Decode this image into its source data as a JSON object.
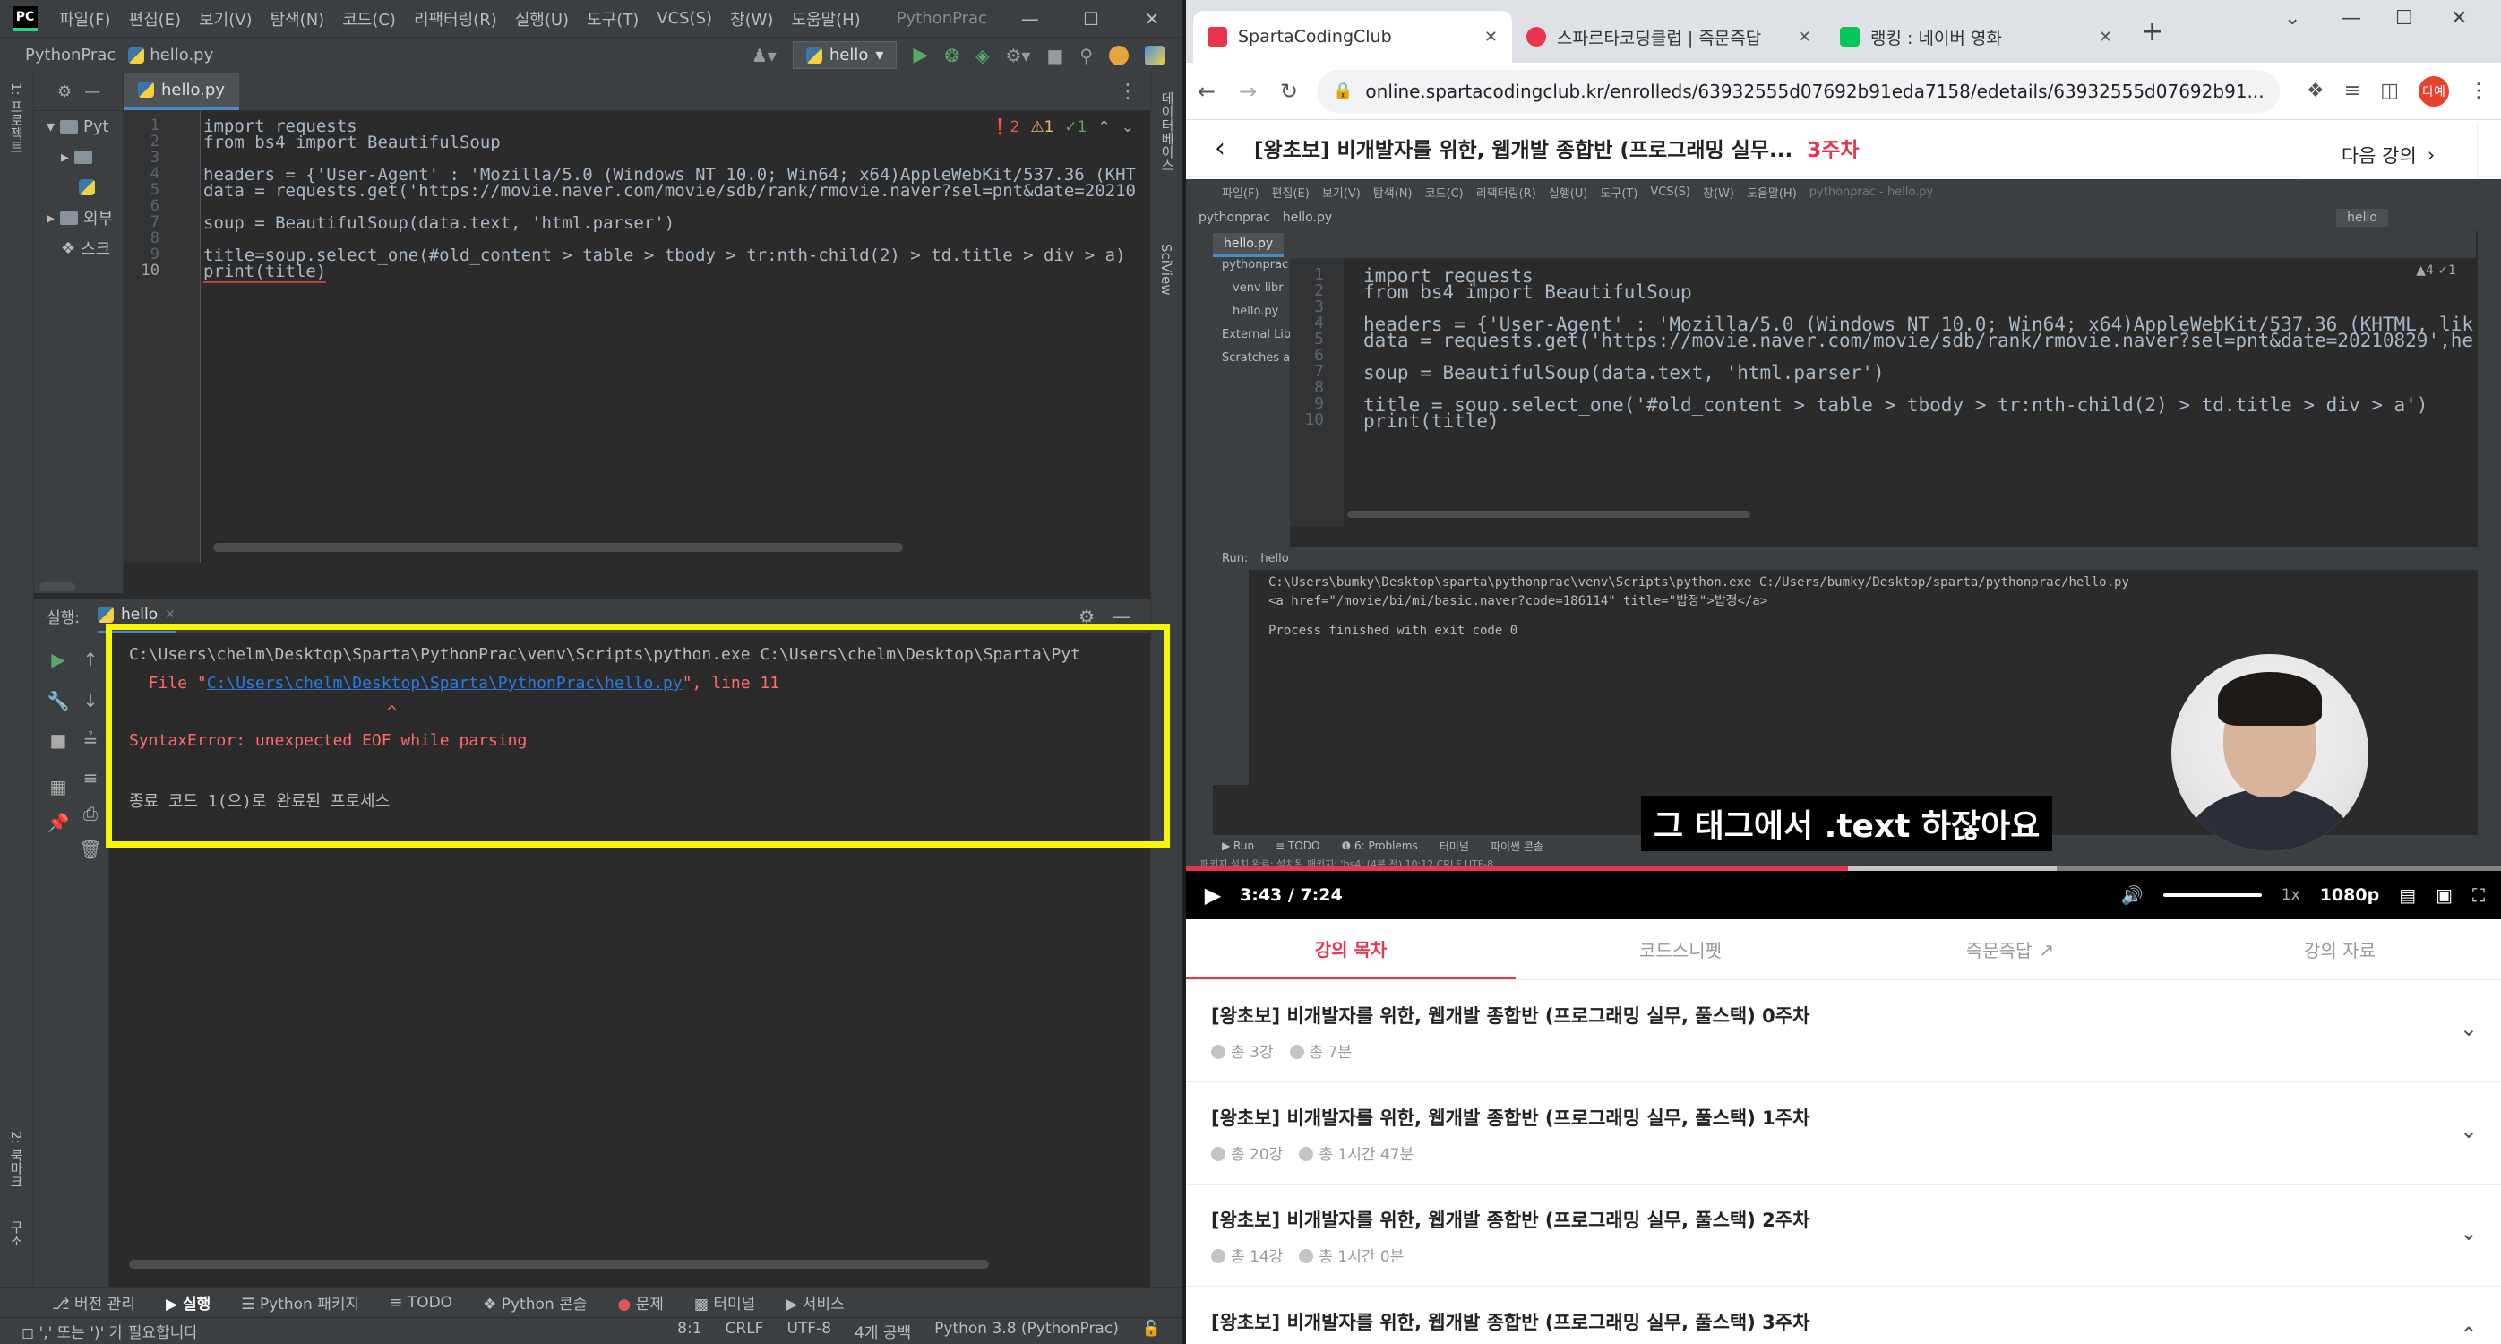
{
  "ide": {
    "menu": [
      "파일(F)",
      "편집(E)",
      "보기(V)",
      "탐색(N)",
      "코드(C)",
      "리팩터링(R)",
      "실행(U)",
      "도구(T)",
      "VCS(S)",
      "창(W)",
      "도움말(H)"
    ],
    "window_title": "PythonPrac",
    "breadcrumb_project": "PythonPrac",
    "breadcrumb_file": "hello.py",
    "run_config": "hello",
    "project_tree": [
      "Pyt",
      "외부",
      "스크"
    ],
    "left_strip_label": "1: 프로젝트",
    "left_strip_label_bottom": "2: 북마크",
    "left_strip_label_bottom2": "구조",
    "right_strip_label": "데이터베이스",
    "right_strip_label2": "SciView",
    "editor_tab": "hello.py",
    "inspections": {
      "errors": "2",
      "warnings": "1",
      "ok": "1"
    },
    "code": [
      {
        "no": "1",
        "text": "import requests"
      },
      {
        "no": "2",
        "text": "from bs4 import BeautifulSoup"
      },
      {
        "no": "3",
        "text": ""
      },
      {
        "no": "4",
        "text": "headers = {'User-Agent' : 'Mozilla/5.0 (Windows NT 10.0; Win64; x64)AppleWebKit/537.36 (KHT"
      },
      {
        "no": "5",
        "text": "data = requests.get('https://movie.naver.com/movie/sdb/rank/rmovie.naver?sel=pnt&date=20210"
      },
      {
        "no": "6",
        "text": ""
      },
      {
        "no": "7",
        "text": "soup = BeautifulSoup(data.text, 'html.parser')"
      },
      {
        "no": "8",
        "text": ""
      },
      {
        "no": "9",
        "text": "title=soup.select_one(#old_content > table > tbody > tr:nth-child(2) > td.title > div > a)"
      },
      {
        "no": "10",
        "text": "print(title)"
      }
    ],
    "run_label": "실행:",
    "run_tab": "hello",
    "console": {
      "line1": "C:\\Users\\chelm\\Desktop\\Sparta\\PythonPrac\\venv\\Scripts\\python.exe C:\\Users\\chelm\\Desktop\\Sparta\\Pyt",
      "line2_prefix": "  File \"",
      "line2_link": "C:\\Users\\chelm\\Desktop\\Sparta\\PythonPrac\\hello.py",
      "line2_suffix": "\", line 11",
      "caret": "^",
      "error": "SyntaxError: unexpected EOF while parsing",
      "exit": "종료 코드 1(으)로 완료된 프로세스"
    },
    "tool_tabs": [
      "버전 관리",
      "실행",
      "Python 패키지",
      "TODO",
      "Python 콘솔",
      "문제",
      "터미널",
      "서비스"
    ],
    "status": {
      "message": "',' 또는 ')' 가 필요합니다",
      "position": "8:1",
      "line_sep": "CRLF",
      "encoding": "UTF-8",
      "indent": "4개 공백",
      "interpreter": "Python 3.8 (PythonPrac)"
    }
  },
  "browser": {
    "tabs": [
      {
        "title": "SpartaCodingClub",
        "color": "#e8344e"
      },
      {
        "title": "스파르타코딩클럽 | 즉문즉답",
        "color": "#e8344e"
      },
      {
        "title": "랭킹 : 네이버 영화",
        "color": "#03c75a"
      }
    ],
    "url": "online.spartacodingclub.kr/enrolleds/63932555d07692b91eda7158/edetails/63932555d07692b91...",
    "profile": "다예",
    "lecture_title": "[왕초보] 비개발자를 위한, 웹개발 종합반 (프로그래밍 실무...",
    "lecture_week": "3주차",
    "next_lecture": "다음 강의",
    "video": {
      "menu": [
        "파일(F)",
        "편집(E)",
        "보기(V)",
        "탐색(N)",
        "코드(C)",
        "리팩터링(R)",
        "실행(U)",
        "도구(T)",
        "VCS(S)",
        "창(W)",
        "도움말(H)",
        "pythonprac - hello.py"
      ],
      "project": "pythonprac",
      "file": "hello.py",
      "run_config": "hello",
      "tree": [
        "pythonprac",
        "venv libr",
        "hello.py",
        "External Libr",
        "Scratches an"
      ],
      "inspections": "▲4  ✓1",
      "code": [
        {
          "no": "1",
          "text": "import requests"
        },
        {
          "no": "2",
          "text": "from bs4 import BeautifulSoup"
        },
        {
          "no": "3",
          "text": ""
        },
        {
          "no": "4",
          "text": "headers = {'User-Agent' : 'Mozilla/5.0 (Windows NT 10.0; Win64; x64)AppleWebKit/537.36 (KHTML, lik"
        },
        {
          "no": "5",
          "text": "data = requests.get('https://movie.naver.com/movie/sdb/rank/rmovie.naver?sel=pnt&date=20210829',he"
        },
        {
          "no": "6",
          "text": ""
        },
        {
          "no": "7",
          "text": "soup = BeautifulSoup(data.text, 'html.parser')"
        },
        {
          "no": "8",
          "text": ""
        },
        {
          "no": "9",
          "text": "title = soup.select_one('#old_content > table > tbody > tr:nth-child(2) > td.title > div > a')"
        },
        {
          "no": "10",
          "text": "print(title)"
        }
      ],
      "run_label": "Run:",
      "run_tab": "hello",
      "console": [
        "C:\\Users\\bumky\\Desktop\\sparta\\pythonprac\\venv\\Scripts\\python.exe C:/Users/bumky/Desktop/sparta/pythonprac/hello.py",
        "<a href=\"/movie/bi/mi/basic.naver?code=186114\" title=\"밥정\">밥정</a>",
        "",
        "Process finished with exit code 0"
      ],
      "tool_tabs": [
        "▶ Run",
        "≡ TODO",
        "❶ 6: Problems",
        "터미널",
        "파이썬 콘솔"
      ],
      "status": "패키지 설치 완료: 설치된 패키지: 'bs4' (4분 전)    10:12  CRLF  UTF-8",
      "caption": "그 태그에서 .text 하잖아요",
      "time_current": "3:43",
      "time_sep": "/",
      "time_total": "7:24",
      "progress": 0.502,
      "buffered": 0.66,
      "speed": "1x",
      "quality": "1080p"
    },
    "lecture_tabs": [
      "강의 목차",
      "코드스니펫",
      "즉문즉답",
      "강의 자료"
    ],
    "weeks": [
      {
        "title": "[왕초보] 비개발자를 위한, 웹개발 종합반 (프로그래밍 실무, 풀스택) 0주차",
        "count": "총 3강",
        "duration": "총 7분"
      },
      {
        "title": "[왕초보] 비개발자를 위한, 웹개발 종합반 (프로그래밍 실무, 풀스택) 1주차",
        "count": "총 20강",
        "duration": "총 1시간 47분"
      },
      {
        "title": "[왕초보] 비개발자를 위한, 웹개발 종합반 (프로그래밍 실무, 풀스택) 2주차",
        "count": "총 14강",
        "duration": "총 1시간 0분"
      },
      {
        "title": "[왕초보] 비개발자를 위한, 웹개발 종합반 (프로그래밍 실무, 풀스택) 3주차",
        "count": "",
        "duration": ""
      }
    ]
  }
}
